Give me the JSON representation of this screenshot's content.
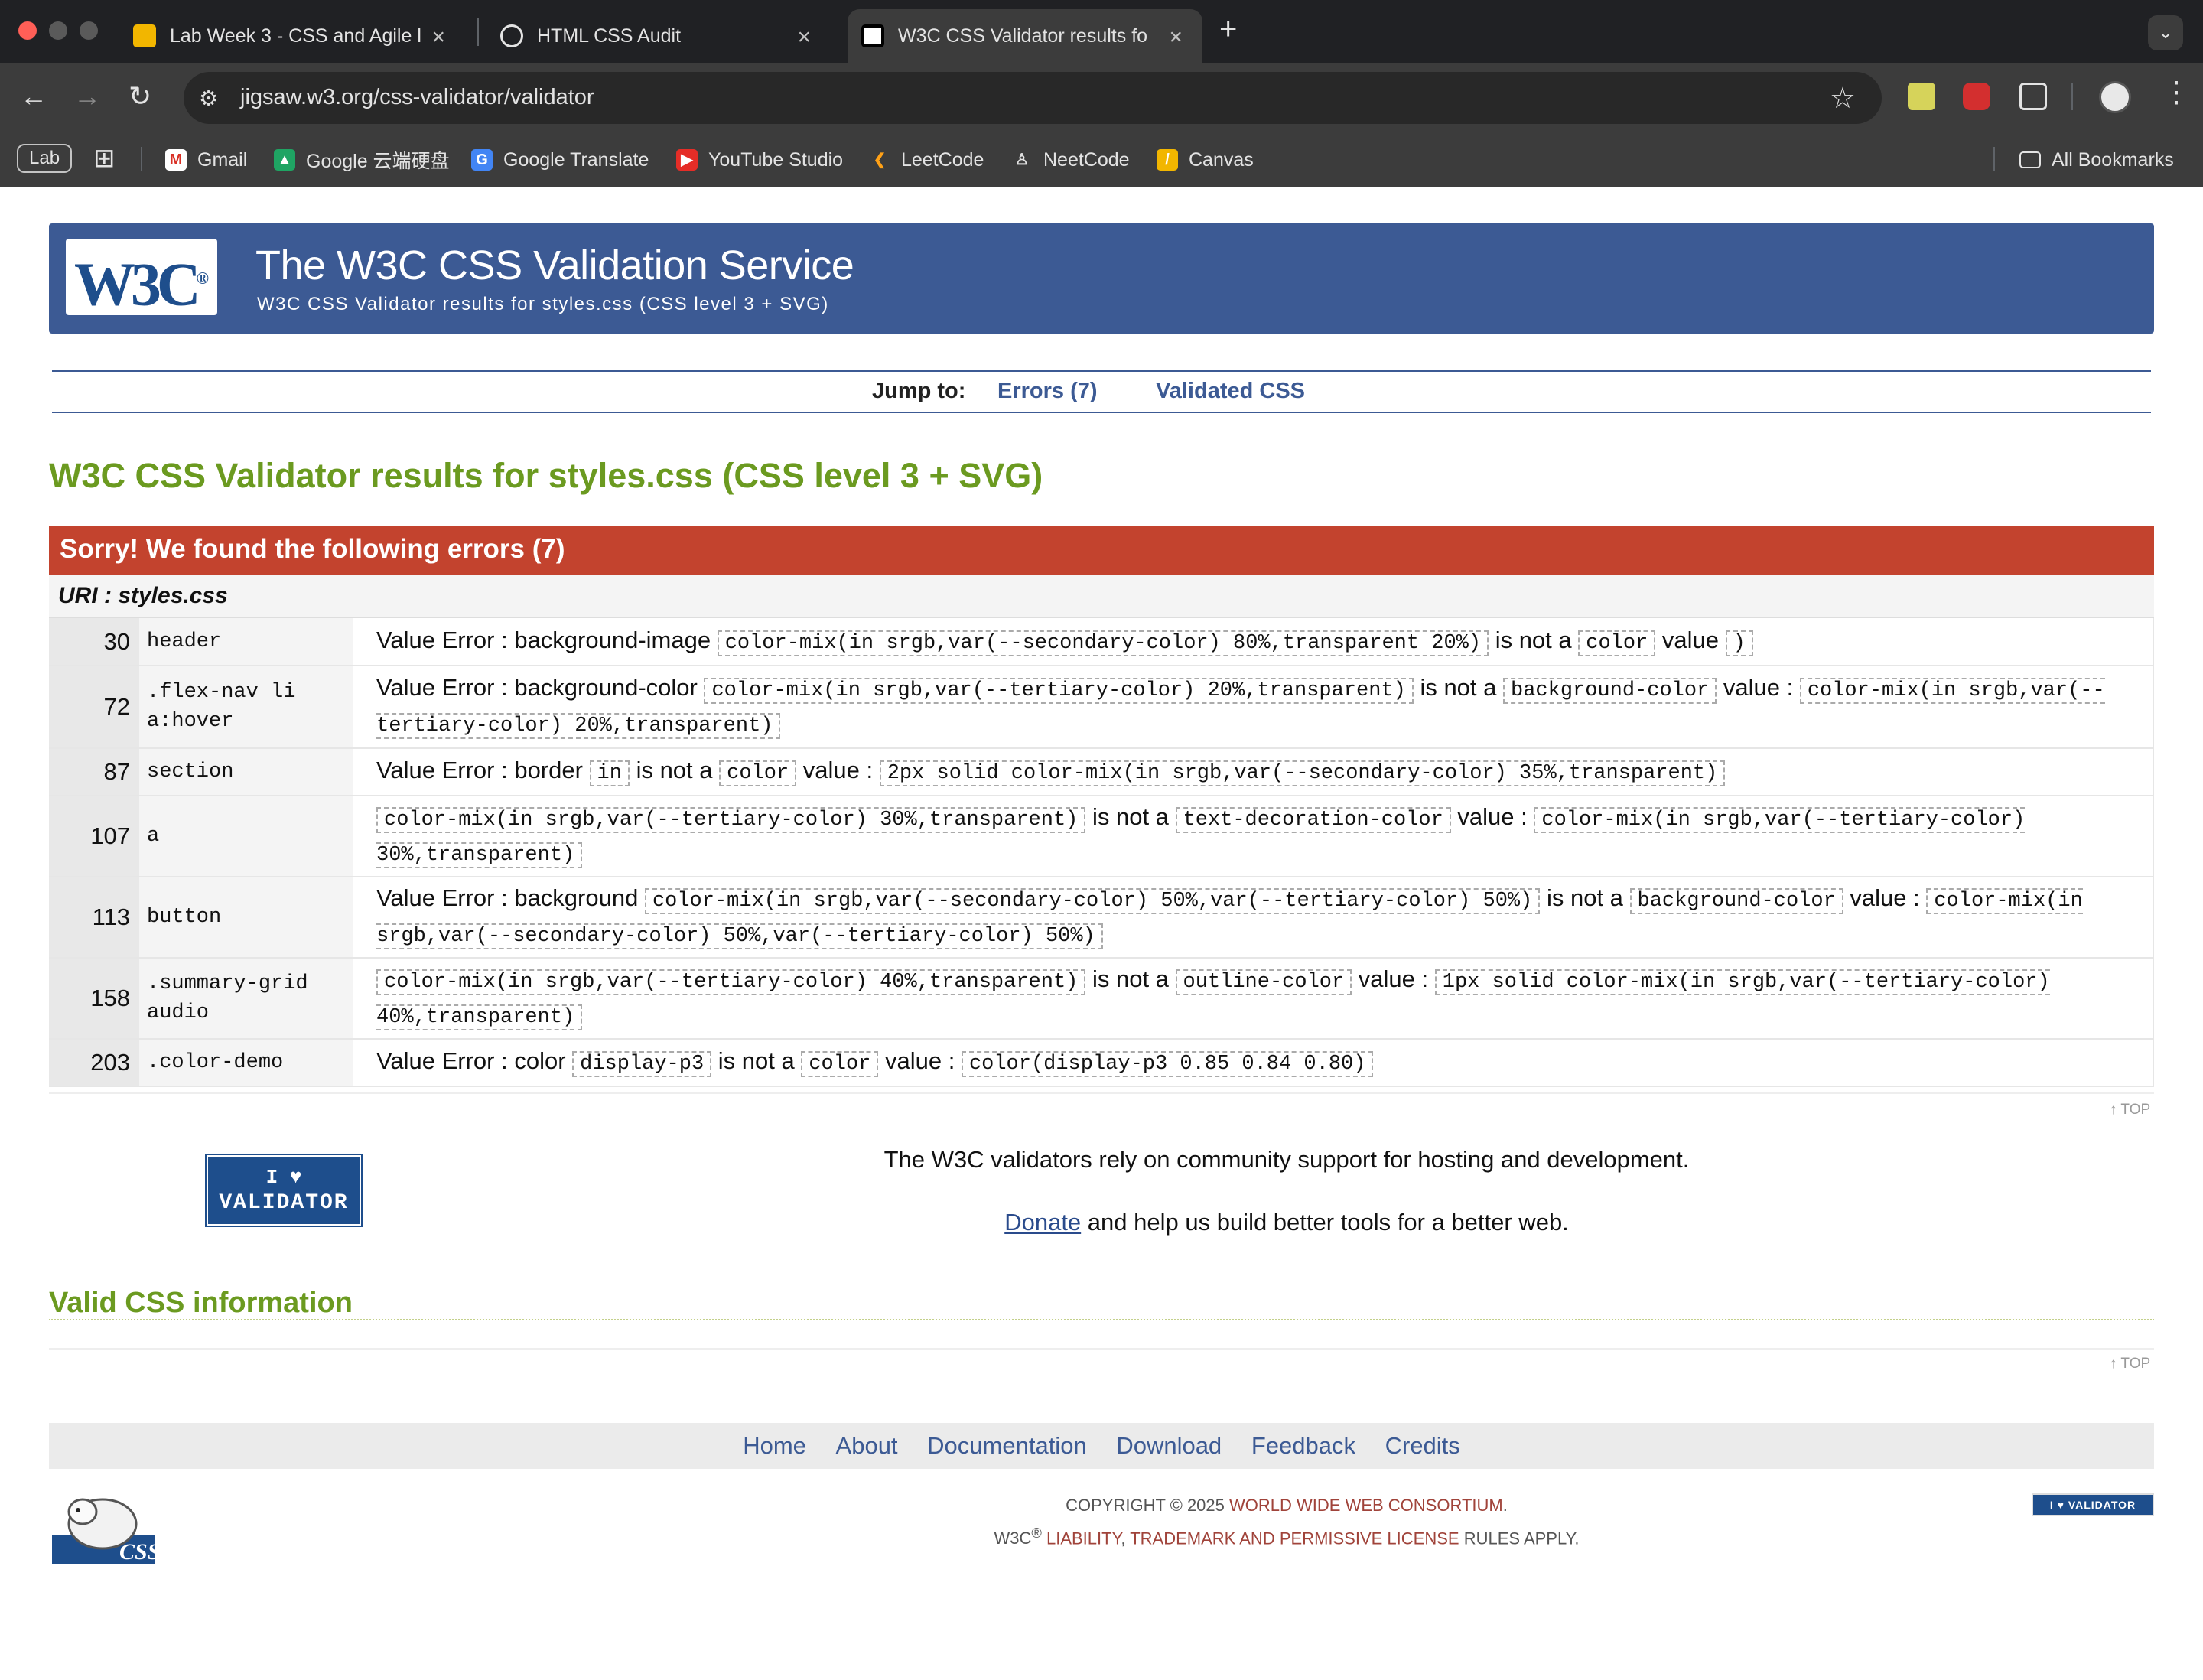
{
  "tabs": [
    {
      "title": "Lab Week 3 - CSS and Agile l",
      "active": false
    },
    {
      "title": "HTML CSS Audit",
      "active": false
    },
    {
      "title": "W3C CSS Validator results fo",
      "active": true
    }
  ],
  "toolbar": {
    "url": "jigsaw.w3.org/css-validator/validator"
  },
  "bookmarks": {
    "group_label": "Lab",
    "items": [
      "Gmail",
      "Google 云端硬盘",
      "Google Translate",
      "YouTube Studio",
      "LeetCode",
      "NeetCode",
      "Canvas"
    ],
    "all_label": "All Bookmarks"
  },
  "banner": {
    "logo": "W3C",
    "title": "The W3C CSS Validation Service",
    "subtitle": "W3C CSS Validator results for styles.css (CSS level 3 + SVG)"
  },
  "jump": {
    "label": "Jump to:",
    "errors_link": "Errors (7)",
    "validated_link": "Validated CSS"
  },
  "results_title": "W3C CSS Validator results for styles.css (CSS level 3 + SVG)",
  "errors": {
    "heading": "Sorry! We found the following errors (7)",
    "uri": "URI : styles.css",
    "rows": [
      {
        "line": "30",
        "selector": "header",
        "parts": [
          {
            "t": "Value Error : background-image "
          },
          {
            "c": "color-mix(in srgb,var(--secondary-color) 80%,transparent 20%)"
          },
          {
            "t": " is not a "
          },
          {
            "c": "color"
          },
          {
            "t": " value "
          },
          {
            "c": ")"
          }
        ]
      },
      {
        "line": "72",
        "selector": ".flex-nav li a:hover",
        "parts": [
          {
            "t": "Value Error : background-color "
          },
          {
            "c": "color-mix(in srgb,var(--tertiary-color) 20%,transparent)"
          },
          {
            "t": " is not a "
          },
          {
            "c": "background-color"
          },
          {
            "t": " value : "
          },
          {
            "c": "color-mix(in srgb,var(--tertiary-color) 20%,transparent)"
          }
        ]
      },
      {
        "line": "87",
        "selector": "section",
        "parts": [
          {
            "t": "Value Error : border "
          },
          {
            "c": "in"
          },
          {
            "t": " is not a "
          },
          {
            "c": "color"
          },
          {
            "t": " value : "
          },
          {
            "c": "2px solid color-mix(in srgb,var(--secondary-color) 35%,transparent)"
          }
        ]
      },
      {
        "line": "107",
        "selector": "a",
        "parts": [
          {
            "c": "color-mix(in srgb,var(--tertiary-color) 30%,transparent)"
          },
          {
            "t": " is not a "
          },
          {
            "c": "text-decoration-color"
          },
          {
            "t": " value : "
          },
          {
            "c": "color-mix(in srgb,var(--tertiary-color) 30%,transparent)"
          }
        ]
      },
      {
        "line": "113",
        "selector": "button",
        "parts": [
          {
            "t": "Value Error : background "
          },
          {
            "c": "color-mix(in srgb,var(--secondary-color) 50%,var(--tertiary-color) 50%)"
          },
          {
            "t": " is not a "
          },
          {
            "c": "background-color"
          },
          {
            "t": " value : "
          },
          {
            "c": "color-mix(in srgb,var(--secondary-color) 50%,var(--tertiary-color) 50%)"
          }
        ]
      },
      {
        "line": "158",
        "selector": ".summary-grid audio",
        "parts": [
          {
            "c": "color-mix(in srgb,var(--tertiary-color) 40%,transparent)"
          },
          {
            "t": " is not a "
          },
          {
            "c": "outline-color"
          },
          {
            "t": " value : "
          },
          {
            "c": "1px solid color-mix(in srgb,var(--tertiary-color) 40%,transparent)"
          }
        ]
      },
      {
        "line": "203",
        "selector": ".color-demo",
        "parts": [
          {
            "t": "Value Error : color "
          },
          {
            "c": "display-p3"
          },
          {
            "t": " is not a "
          },
          {
            "c": "color"
          },
          {
            "t": " value : "
          },
          {
            "c": "color(display-p3 0.85 0.84 0.80)"
          }
        ]
      }
    ]
  },
  "top_label": "↑ TOP",
  "support": {
    "badge_line1": "I ♥",
    "badge_line2": "VALIDATOR",
    "text": "The W3C validators rely on community support for hosting and development.",
    "donate_link": "Donate",
    "donate_rest": " and help us build better tools for a better web."
  },
  "valid_css_title": "Valid CSS information",
  "footer": {
    "nav": [
      "Home",
      "About",
      "Documentation",
      "Download",
      "Feedback",
      "Credits"
    ],
    "copyright_prefix": "COPYRIGHT © 2025 ",
    "copyright_org": "WORLD WIDE WEB CONSORTIUM",
    "copyright_suffix": ".",
    "w3c_mark": "W3C",
    "reg": "®",
    "liability": " LIABILITY",
    "sep1": ", ",
    "trademark": "TRADEMARK",
    "and": " AND ",
    "license": "PERMISSIVE LICENSE",
    "rules": " RULES APPLY.",
    "sheep_label": "CSS",
    "mini_badge": "I ♥ VALIDATOR"
  },
  "colors": {
    "banner": "#3c5a94",
    "error_header": "#c3432e",
    "title_green": "#6b9a20",
    "link_blue": "#3c5a94"
  }
}
